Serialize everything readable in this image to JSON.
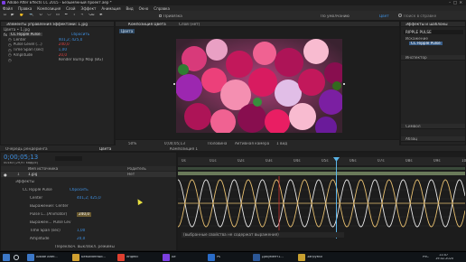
{
  "window": {
    "title": "Adobe After Effects CC 2015 - Безымянный проект.aep *"
  },
  "menu": [
    "Файл",
    "Правка",
    "Композиция",
    "Слой",
    "Эффект",
    "Анимация",
    "Вид",
    "Окно",
    "Справка"
  ],
  "toolbar": {
    "snap_label": "Привязка",
    "default_label": "По умолчанию",
    "workspace_label": "Цвет",
    "search_placeholder": "Поиск в справке"
  },
  "effect_controls": {
    "tab_label": "Элементы управления эффектами: 1.jpg",
    "breadcrumb": "Цвета • 1.jpg",
    "effect_name": "CC Ripple Pulse",
    "reset_label": "Сбросить",
    "props": [
      {
        "name": "Center",
        "value": "401,2; 425,0"
      },
      {
        "name": "Pulse Level (...)",
        "value": "240,0"
      },
      {
        "name": "Time Span (sec)",
        "value": "1,00"
      },
      {
        "name": "Amplitude",
        "value": "20,0"
      },
      {
        "name": "",
        "value": "Render Bump Map (BG)"
      }
    ]
  },
  "composition": {
    "tab_label": "Композиция Цвета",
    "layer_label": "Слой (нет)",
    "subtab": "Цвета",
    "zoom": "50%",
    "timecode": "0;00;05;13",
    "quality": "Половина",
    "camera": "Активная камера",
    "views": "1 вид"
  },
  "effects_presets": {
    "title": "Эффекты и шаблоны",
    "search_value": "RIPPLE PULSE",
    "folder": "Искажение",
    "item": "CC Ripple Pulse",
    "preview_tab": "Инспектор",
    "align_tab": "Символ",
    "paragraph_tab": "Абзац"
  },
  "render_queue": {
    "tab_label": "Очередь рендеринга",
    "timeline_tab": "Цвета",
    "comp_tab": "Композиция 1"
  },
  "timeline": {
    "timecode": "0;00;05;13",
    "frames": "00163 (29,97 кадр/с)",
    "source_col": "Имя источника",
    "parent_col": "Родитель",
    "layer_index": "1",
    "layer_name": "1.jpg",
    "parent_value": "Нет",
    "rows": [
      {
        "indent": 1,
        "name": "Эффекты",
        "value": ""
      },
      {
        "indent": 2,
        "name": "CC Ripple Pulse",
        "value": "Сбросить"
      },
      {
        "indent": 3,
        "name": "Center",
        "value": "401,2; 425,0"
      },
      {
        "indent": 3,
        "name": "Выражение: Center",
        "value": ""
      },
      {
        "indent": 3,
        "name": "Pulse L...(Animator)",
        "value": "240,0"
      },
      {
        "indent": 3,
        "name": "Выражен... Pulse Lev",
        "value": ""
      },
      {
        "indent": 3,
        "name": "Time Span (sec)",
        "value": "1,00"
      },
      {
        "indent": 3,
        "name": "Amplitude",
        "value": "20,0"
      }
    ],
    "ruler": [
      "0s",
      "01s",
      "02s",
      "03s",
      "04s",
      "05s",
      "06s",
      "07s",
      "08s",
      "09s",
      "10s"
    ],
    "graph_note": "(выбранные свойства не содержат выражения)",
    "bottom_label": "Переключ. выкл/вкл. режимы"
  },
  "right_panels": {
    "preview": "Символ",
    "paragraph": "Абзац"
  },
  "taskbar": {
    "items": [
      "Adobe After...",
      "Безымянный...",
      "Яндекс",
      "Ae",
      "Ps",
      "Документ1...",
      "Загрузки"
    ],
    "lang": "РУС",
    "time": "11:47",
    "date": "19.02.2020"
  },
  "colors": {
    "accent": "#3e8fe0",
    "playhead": "#5ab4e8",
    "graph_white": "#e8e8e8",
    "graph_yellow": "#e8c070",
    "ruler_green": "#3a8a4a"
  }
}
